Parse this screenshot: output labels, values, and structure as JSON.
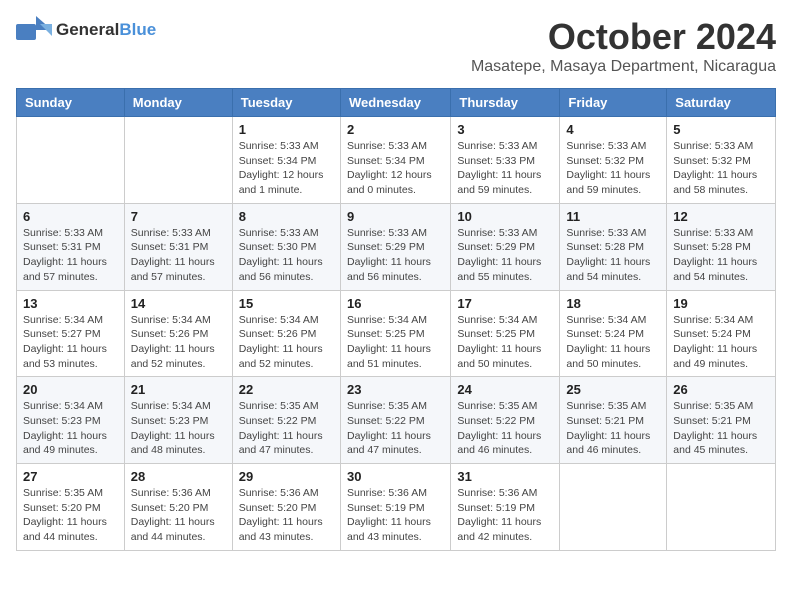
{
  "logo": {
    "general": "General",
    "blue": "Blue"
  },
  "title": {
    "month_year": "October 2024",
    "location": "Masatepe, Masaya Department, Nicaragua"
  },
  "headers": [
    "Sunday",
    "Monday",
    "Tuesday",
    "Wednesday",
    "Thursday",
    "Friday",
    "Saturday"
  ],
  "weeks": [
    [
      {
        "day": "",
        "info": ""
      },
      {
        "day": "",
        "info": ""
      },
      {
        "day": "1",
        "info": "Sunrise: 5:33 AM\nSunset: 5:34 PM\nDaylight: 12 hours and 1 minute."
      },
      {
        "day": "2",
        "info": "Sunrise: 5:33 AM\nSunset: 5:34 PM\nDaylight: 12 hours and 0 minutes."
      },
      {
        "day": "3",
        "info": "Sunrise: 5:33 AM\nSunset: 5:33 PM\nDaylight: 11 hours and 59 minutes."
      },
      {
        "day": "4",
        "info": "Sunrise: 5:33 AM\nSunset: 5:32 PM\nDaylight: 11 hours and 59 minutes."
      },
      {
        "day": "5",
        "info": "Sunrise: 5:33 AM\nSunset: 5:32 PM\nDaylight: 11 hours and 58 minutes."
      }
    ],
    [
      {
        "day": "6",
        "info": "Sunrise: 5:33 AM\nSunset: 5:31 PM\nDaylight: 11 hours and 57 minutes."
      },
      {
        "day": "7",
        "info": "Sunrise: 5:33 AM\nSunset: 5:31 PM\nDaylight: 11 hours and 57 minutes."
      },
      {
        "day": "8",
        "info": "Sunrise: 5:33 AM\nSunset: 5:30 PM\nDaylight: 11 hours and 56 minutes."
      },
      {
        "day": "9",
        "info": "Sunrise: 5:33 AM\nSunset: 5:29 PM\nDaylight: 11 hours and 56 minutes."
      },
      {
        "day": "10",
        "info": "Sunrise: 5:33 AM\nSunset: 5:29 PM\nDaylight: 11 hours and 55 minutes."
      },
      {
        "day": "11",
        "info": "Sunrise: 5:33 AM\nSunset: 5:28 PM\nDaylight: 11 hours and 54 minutes."
      },
      {
        "day": "12",
        "info": "Sunrise: 5:33 AM\nSunset: 5:28 PM\nDaylight: 11 hours and 54 minutes."
      }
    ],
    [
      {
        "day": "13",
        "info": "Sunrise: 5:34 AM\nSunset: 5:27 PM\nDaylight: 11 hours and 53 minutes."
      },
      {
        "day": "14",
        "info": "Sunrise: 5:34 AM\nSunset: 5:26 PM\nDaylight: 11 hours and 52 minutes."
      },
      {
        "day": "15",
        "info": "Sunrise: 5:34 AM\nSunset: 5:26 PM\nDaylight: 11 hours and 52 minutes."
      },
      {
        "day": "16",
        "info": "Sunrise: 5:34 AM\nSunset: 5:25 PM\nDaylight: 11 hours and 51 minutes."
      },
      {
        "day": "17",
        "info": "Sunrise: 5:34 AM\nSunset: 5:25 PM\nDaylight: 11 hours and 50 minutes."
      },
      {
        "day": "18",
        "info": "Sunrise: 5:34 AM\nSunset: 5:24 PM\nDaylight: 11 hours and 50 minutes."
      },
      {
        "day": "19",
        "info": "Sunrise: 5:34 AM\nSunset: 5:24 PM\nDaylight: 11 hours and 49 minutes."
      }
    ],
    [
      {
        "day": "20",
        "info": "Sunrise: 5:34 AM\nSunset: 5:23 PM\nDaylight: 11 hours and 49 minutes."
      },
      {
        "day": "21",
        "info": "Sunrise: 5:34 AM\nSunset: 5:23 PM\nDaylight: 11 hours and 48 minutes."
      },
      {
        "day": "22",
        "info": "Sunrise: 5:35 AM\nSunset: 5:22 PM\nDaylight: 11 hours and 47 minutes."
      },
      {
        "day": "23",
        "info": "Sunrise: 5:35 AM\nSunset: 5:22 PM\nDaylight: 11 hours and 47 minutes."
      },
      {
        "day": "24",
        "info": "Sunrise: 5:35 AM\nSunset: 5:22 PM\nDaylight: 11 hours and 46 minutes."
      },
      {
        "day": "25",
        "info": "Sunrise: 5:35 AM\nSunset: 5:21 PM\nDaylight: 11 hours and 46 minutes."
      },
      {
        "day": "26",
        "info": "Sunrise: 5:35 AM\nSunset: 5:21 PM\nDaylight: 11 hours and 45 minutes."
      }
    ],
    [
      {
        "day": "27",
        "info": "Sunrise: 5:35 AM\nSunset: 5:20 PM\nDaylight: 11 hours and 44 minutes."
      },
      {
        "day": "28",
        "info": "Sunrise: 5:36 AM\nSunset: 5:20 PM\nDaylight: 11 hours and 44 minutes."
      },
      {
        "day": "29",
        "info": "Sunrise: 5:36 AM\nSunset: 5:20 PM\nDaylight: 11 hours and 43 minutes."
      },
      {
        "day": "30",
        "info": "Sunrise: 5:36 AM\nSunset: 5:19 PM\nDaylight: 11 hours and 43 minutes."
      },
      {
        "day": "31",
        "info": "Sunrise: 5:36 AM\nSunset: 5:19 PM\nDaylight: 11 hours and 42 minutes."
      },
      {
        "day": "",
        "info": ""
      },
      {
        "day": "",
        "info": ""
      }
    ]
  ]
}
